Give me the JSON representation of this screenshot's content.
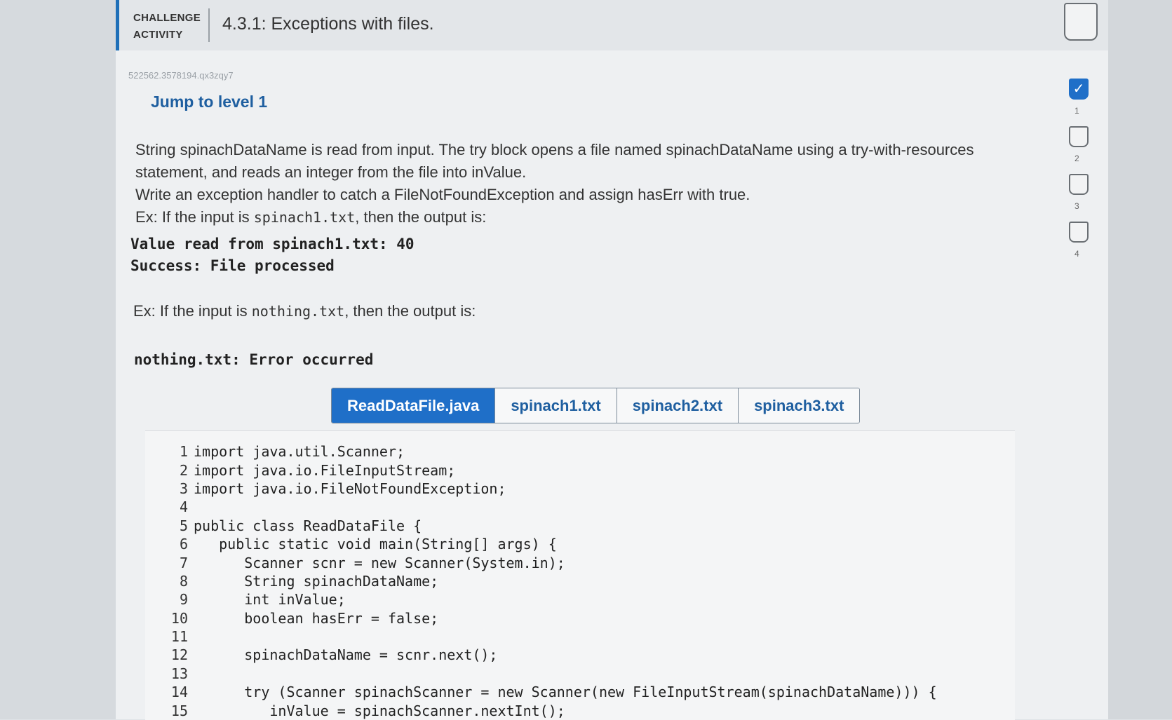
{
  "header": {
    "tag_line1": "CHALLENGE",
    "tag_line2": "ACTIVITY",
    "title": "4.3.1: Exceptions with files."
  },
  "activity_id": "522562.3578194.qx3zqy7",
  "jump_label": "Jump to level 1",
  "description": {
    "p1": "String spinachDataName is read from input. The try block opens a file named spinachDataName using a try-with-resources statement, and reads an integer from the file into inValue.",
    "p2": "Write an exception handler to catch a FileNotFoundException and assign hasErr with true.",
    "ex1_prefix": "Ex: If the input is ",
    "ex1_code": "spinach1.txt",
    "ex1_suffix": ", then the output is:"
  },
  "output1": [
    "Value read from spinach1.txt: 40",
    "Success: File processed"
  ],
  "example2": {
    "prefix": "Ex: If the input is ",
    "code": "nothing.txt",
    "suffix": ", then the output is:"
  },
  "output2": [
    "nothing.txt: Error occurred"
  ],
  "tabs": [
    {
      "label": "ReadDataFile.java",
      "active": true
    },
    {
      "label": "spinach1.txt",
      "active": false
    },
    {
      "label": "spinach2.txt",
      "active": false
    },
    {
      "label": "spinach3.txt",
      "active": false
    }
  ],
  "code_lines": [
    {
      "n": "1",
      "text": "import java.util.Scanner;"
    },
    {
      "n": "2",
      "text": "import java.io.FileInputStream;"
    },
    {
      "n": "3",
      "text": "import java.io.FileNotFoundException;"
    },
    {
      "n": "4",
      "text": ""
    },
    {
      "n": "5",
      "text": "public class ReadDataFile {"
    },
    {
      "n": "6",
      "text": "   public static void main(String[] args) {"
    },
    {
      "n": "7",
      "text": "      Scanner scnr = new Scanner(System.in);"
    },
    {
      "n": "8",
      "text": "      String spinachDataName;"
    },
    {
      "n": "9",
      "text": "      int inValue;"
    },
    {
      "n": "10",
      "text": "      boolean hasErr = false;"
    },
    {
      "n": "11",
      "text": ""
    },
    {
      "n": "12",
      "text": "      spinachDataName = scnr.next();"
    },
    {
      "n": "13",
      "text": ""
    },
    {
      "n": "14",
      "text": "      try (Scanner spinachScanner = new Scanner(new FileInputStream(spinachDataName))) {"
    },
    {
      "n": "15",
      "text": "         inValue = spinachScanner.nextInt();"
    }
  ],
  "levels": [
    {
      "num": "1",
      "done": true
    },
    {
      "num": "2",
      "done": false
    },
    {
      "num": "3",
      "done": false
    },
    {
      "num": "4",
      "done": false
    }
  ],
  "check_icon": "✓",
  "colors": {
    "accent": "#1f6fc8",
    "link": "#1f5fa0"
  }
}
